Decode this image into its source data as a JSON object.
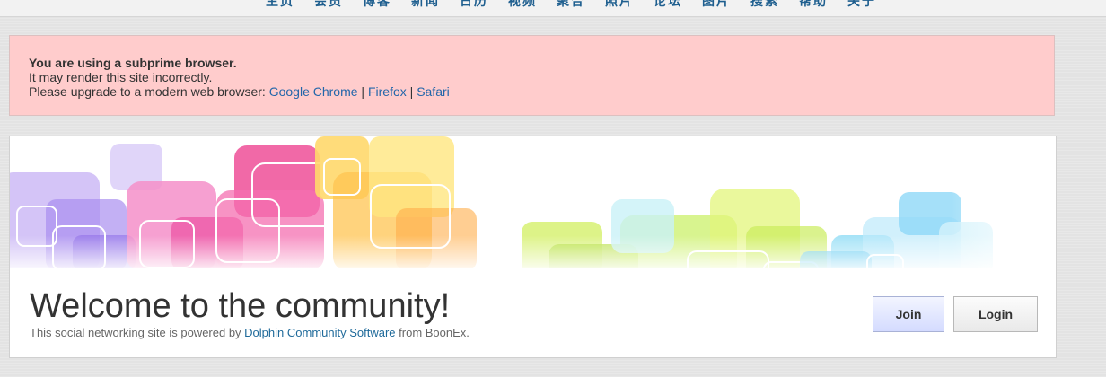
{
  "nav": {
    "items": [
      "主页",
      "会员",
      "博客",
      "新闻",
      "日历",
      "视频",
      "聚合",
      "照片",
      "论坛",
      "图片",
      "搜索",
      "帮助",
      "关于"
    ]
  },
  "warning": {
    "title": "You are using a subprime browser.",
    "line1": "It may render this site incorrectly.",
    "line2_prefix": "Please upgrade to a modern web browser: ",
    "links": [
      "Google Chrome",
      "Firefox",
      "Safari"
    ],
    "separator": " | "
  },
  "welcome": {
    "heading": "Welcome to the community!",
    "powered_prefix": "This social networking site is powered by ",
    "powered_link": "Dolphin Community Software",
    "powered_suffix": " from BoonEx."
  },
  "buttons": {
    "join": "Join",
    "login": "Login"
  },
  "colors": {
    "warning_bg": "#ffcccc",
    "link": "#2266aa",
    "nav_link": "#1f5f8f"
  }
}
